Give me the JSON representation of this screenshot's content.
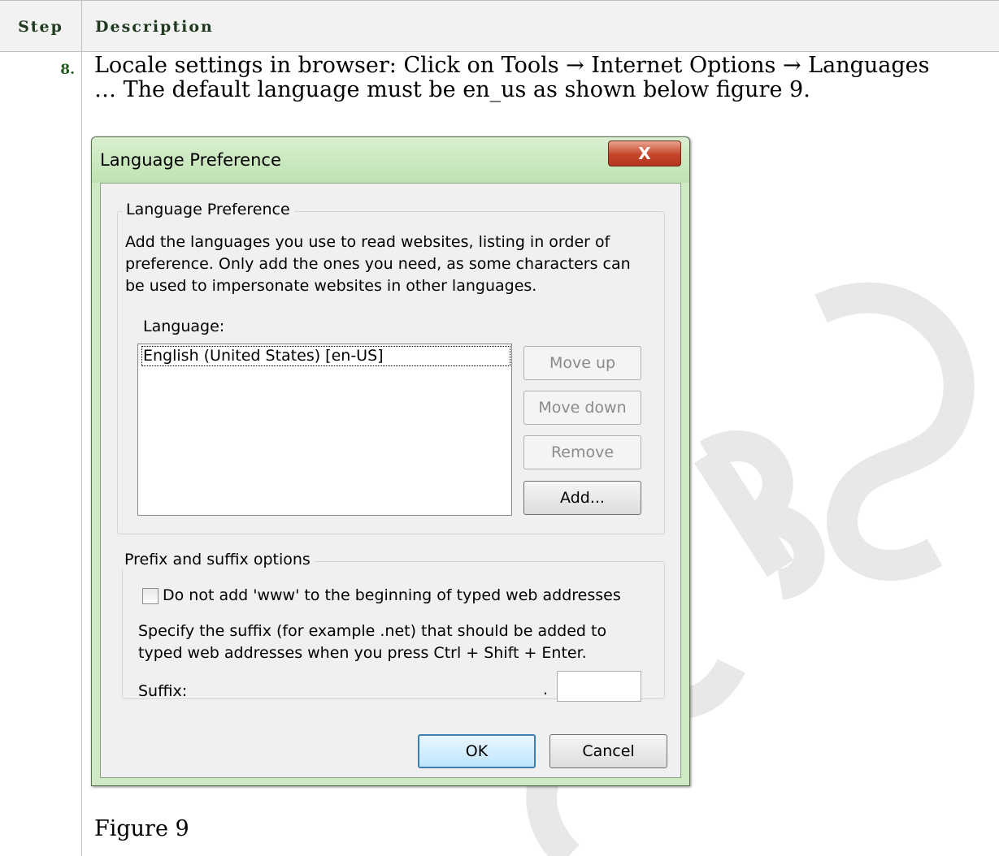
{
  "table": {
    "header_step": "Step",
    "header_description": "Description",
    "step_number": "8.",
    "description_line1": "Locale settings in browser: Click on Tools → Internet Options → Languages",
    "description_line2": "… The default language must be en_us as shown below figure 9.",
    "figure_caption": "Figure 9"
  },
  "dialog": {
    "title": "Language Preference",
    "close_glyph": "X",
    "language_group": {
      "title": "Language Preference",
      "text_line1": "Add the languages you use to read websites, listing in order of",
      "text_line2": "preference. Only add the ones you need, as some characters can",
      "text_line3": "be used to impersonate websites in other languages.",
      "list_label": "Language:",
      "items": [
        "English (United States) [en-US]"
      ],
      "move_up_label": "Move up",
      "move_down_label": "Move down",
      "remove_label": "Remove",
      "add_label": "Add..."
    },
    "prefix_group": {
      "title": "Prefix and suffix options",
      "checkbox_label": "Do not add 'www' to the beginning of typed web addresses",
      "checkbox_checked": false,
      "help_line1": "Specify the suffix (for example .net) that should be added to",
      "help_line2": "typed web addresses when you press Ctrl + Shift + Enter.",
      "suffix_label": "Suffix:",
      "suffix_dot": ".",
      "suffix_value": ""
    },
    "ok_label": "OK",
    "cancel_label": "Cancel"
  },
  "colors": {
    "header_bg": "#f2f2f2",
    "step_number": "#1f5a1f",
    "dialog_frame": "#cfe9c5",
    "close_button": "#c5452a",
    "default_button": "#3c7fb1",
    "watermark": "#e8e8e8"
  }
}
